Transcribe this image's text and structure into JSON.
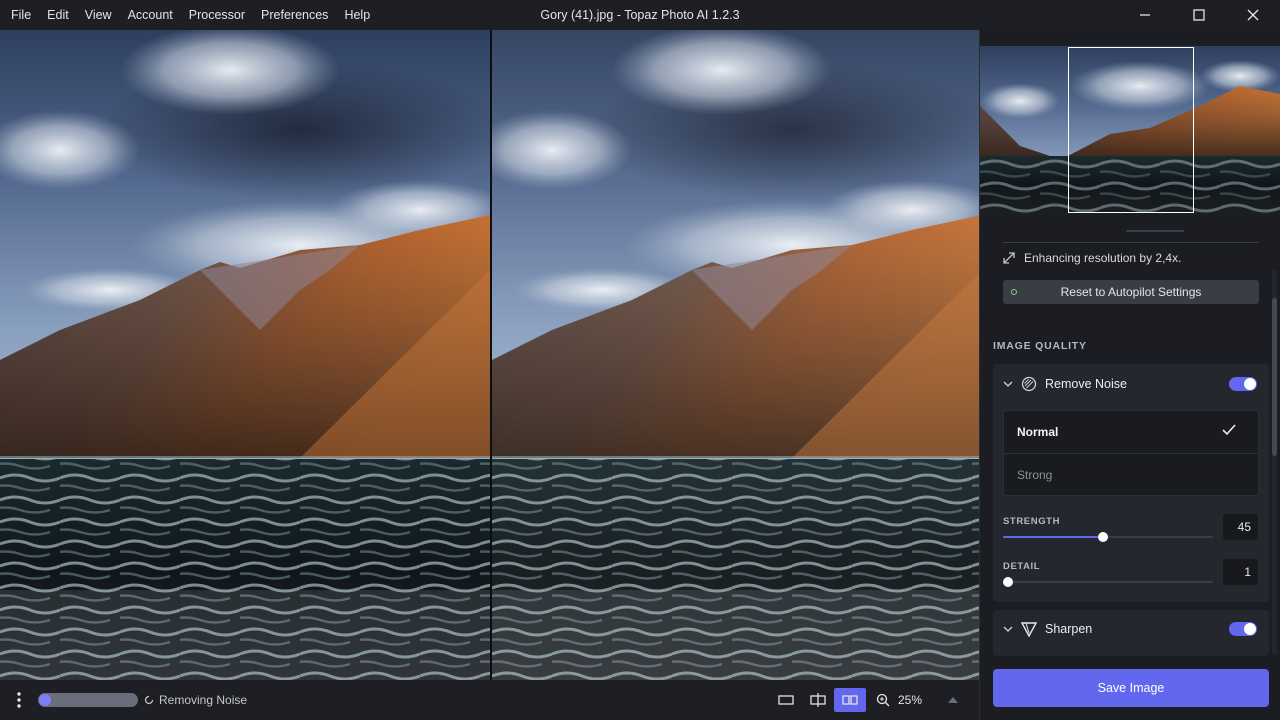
{
  "menu": [
    "File",
    "Edit",
    "View",
    "Account",
    "Processor",
    "Preferences",
    "Help"
  ],
  "window_title": "Gory (41).jpg - Topaz Photo AI 1.2.3",
  "status": {
    "text": "Removing Noise",
    "progress": 0.05
  },
  "zoom": {
    "value": "25%"
  },
  "autopilot": {
    "enhance_text": "Enhancing resolution by 2,4x.",
    "reset_label": "Reset to Autopilot Settings"
  },
  "image_quality": {
    "section_label": "IMAGE QUALITY",
    "remove_noise": {
      "title": "Remove Noise",
      "enabled": true,
      "options": [
        {
          "label": "Normal",
          "selected": true
        },
        {
          "label": "Strong",
          "selected": false
        }
      ],
      "strength_label": "STRENGTH",
      "strength_value": "45",
      "strength_fraction": 0.45,
      "detail_label": "DETAIL",
      "detail_value": "1",
      "detail_fraction": 0.0
    },
    "sharpen": {
      "title": "Sharpen",
      "enabled": true
    }
  },
  "save_label": "Save Image",
  "colors": {
    "accent": "#6267ee",
    "background": "#17191e",
    "panel": "#24272d"
  }
}
